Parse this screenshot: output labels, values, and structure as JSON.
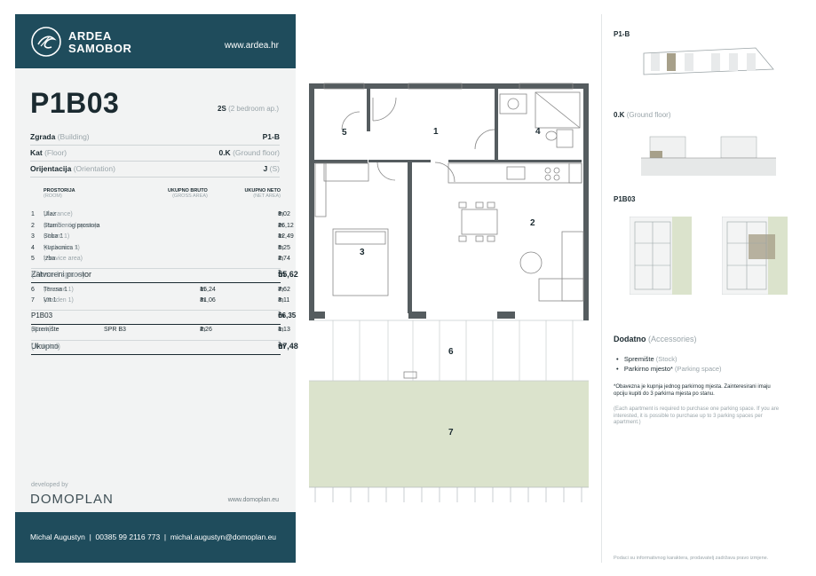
{
  "header": {
    "logo_line1": "ARDEA",
    "logo_line2": "SAMOBOR",
    "website": "www.ardea.hr"
  },
  "unit": {
    "code": "P1B03",
    "type_code": "2S",
    "type_desc": "(2 bedroom ap.)"
  },
  "info": [
    {
      "label": "Zgrada",
      "sub": "(Building)",
      "value": "P1-B",
      "value_sub": ""
    },
    {
      "label": "Kat",
      "sub": "(Floor)",
      "value": "0.K",
      "value_sub": "(Ground floor)"
    },
    {
      "label": "Orijentacija",
      "sub": "(Orientation)",
      "value": "J",
      "value_sub": "(S)"
    }
  ],
  "table_headers": {
    "room": "PROSTORIJA",
    "room_sub": "(ROOM)",
    "gross": "UKUPNO BRUTO",
    "gross_sub": "(GROSS AREA)",
    "net": "UKUPNO NETO",
    "net_sub": "(NET AREA)"
  },
  "rooms": [
    {
      "no": "1",
      "name": "Ulaz",
      "name_en": "(Entrance)",
      "gross": "",
      "net": "9,02"
    },
    {
      "no": "2",
      "name": "Stambenog prostora",
      "name_en": "(Residential space)",
      "gross": "",
      "net": "26,12"
    },
    {
      "no": "3",
      "name": "Soba 1",
      "name_en": "(Room 1)",
      "gross": "",
      "net": "12,49"
    },
    {
      "no": "4",
      "name": "Kupaonica 1",
      "name_en": "(Bathroom 1)",
      "gross": "",
      "net": "5,25"
    },
    {
      "no": "5",
      "name": "Izba",
      "name_en": "(Service area)",
      "gross": "",
      "net": "2,74"
    }
  ],
  "closed": {
    "label": "Zatvoreni prostor",
    "label_en": "(Closed space)",
    "value": "55,62"
  },
  "outdoor": [
    {
      "no": "6",
      "name": "Terasa 1",
      "name_en": "(Terrace 1)",
      "gross": "15,24",
      "net": "7,62"
    },
    {
      "no": "7",
      "name": "Vrt 1",
      "name_en": "(Garden 1)",
      "gross": "31,06",
      "net": "3,11"
    }
  ],
  "subtotal": {
    "label": "P1B03",
    "value": "66,35"
  },
  "storage": {
    "label": "Spremište",
    "label_en": "(Stock)",
    "code": "SPR B3",
    "gross": "2,26",
    "net": "1,13"
  },
  "total": {
    "label": "Ukupno",
    "label_en": "(In total)",
    "value": "67,48"
  },
  "unit_m": "m",
  "unit_exp": "2",
  "developer": {
    "developed_by": "developed by",
    "logo": "DOMOPLAN",
    "website": "www.domoplan.eu"
  },
  "footer": {
    "contact": "Michal Augustyn  |  00385 99 2116 773  |  michal.augustyn@domoplan.eu"
  },
  "plan_labels": [
    "1",
    "2",
    "3",
    "4",
    "5",
    "6",
    "7"
  ],
  "right": {
    "building_label": "P1-B",
    "floor_label": "0.K",
    "floor_label_en": "(Ground floor)",
    "unit_label": "P1B03",
    "accessories_title": "Dodatno",
    "accessories_title_en": "(Accessories)",
    "accessories": [
      {
        "name": "Spremište",
        "name_en": "(Stock)"
      },
      {
        "name": "Parkirno mjesto*",
        "name_en": "(Parking space)"
      }
    ],
    "note_hr": "*Obavezna je kupnja jednog parkirnog mjesta. Zainteresirani imaju opciju kupiti do 3 parkirna mjesta po stanu.",
    "note_en": "(Each apartment is required to purchase one parking space. If you are interested, it is possible to purchase up to 3 parking spaces per apartment.)",
    "disclaimer": "Podaci su informativnog karaktera, prodavatelj zadržava pravo izmjene."
  }
}
